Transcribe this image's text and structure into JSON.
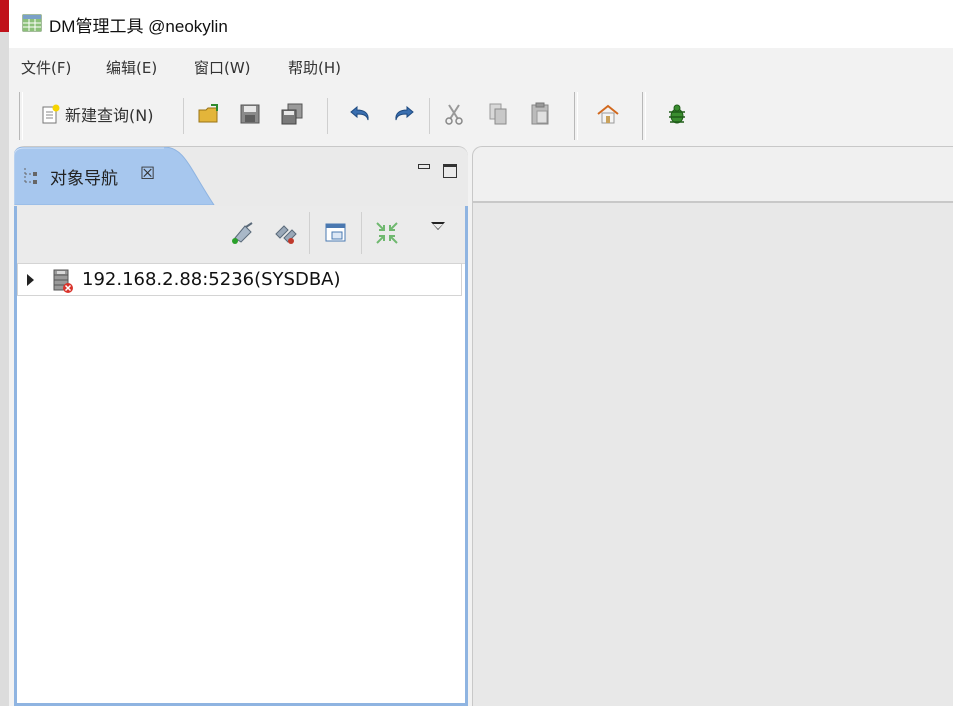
{
  "window": {
    "title": "DM管理工具 @neokylin",
    "icon": "database-table-icon"
  },
  "menubar": {
    "items": [
      {
        "label": "文件(F)"
      },
      {
        "label": "编辑(E)"
      },
      {
        "label": "窗口(W)"
      },
      {
        "label": "帮助(H)"
      }
    ]
  },
  "toolbar": {
    "new_query_label": "新建查询(N)",
    "buttons": [
      {
        "name": "open-icon"
      },
      {
        "name": "save-icon"
      },
      {
        "name": "save-all-icon"
      },
      {
        "name": "undo-icon"
      },
      {
        "name": "redo-icon"
      },
      {
        "name": "cut-icon"
      },
      {
        "name": "copy-icon"
      },
      {
        "name": "paste-icon"
      },
      {
        "name": "home-icon"
      },
      {
        "name": "bug-icon"
      }
    ]
  },
  "navigator": {
    "tab_label": "对象导航",
    "close_glyph": "☒",
    "toolbar_icons": [
      "connect-icon",
      "disconnect-icon",
      "new-window-icon",
      "collapse-all-icon",
      "view-menu-icon"
    ],
    "tree": [
      {
        "label": "192.168.2.88:5236(SYSDBA)",
        "icon": "server-disconnected-icon",
        "expanded": false
      }
    ]
  },
  "colors": {
    "active_tab": "#9fc1ea",
    "panel_border": "#8fb4e1",
    "title_red": "#c0111a"
  }
}
